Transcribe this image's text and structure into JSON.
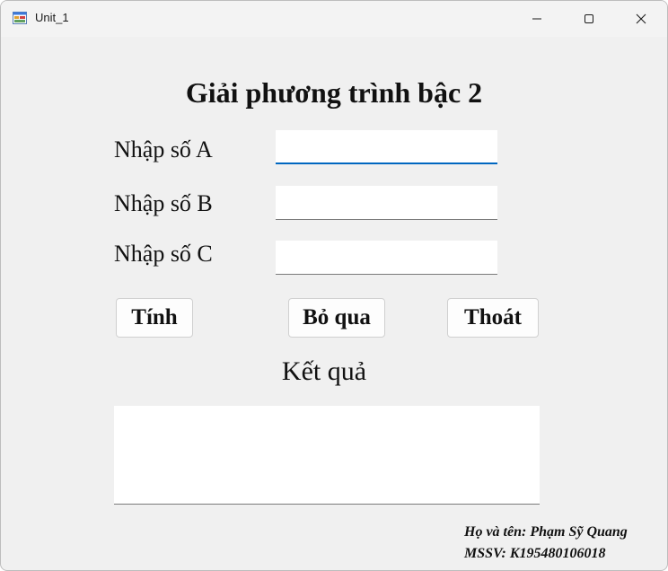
{
  "window": {
    "title": "Unit_1"
  },
  "form": {
    "heading": "Giải phương trình bậc 2",
    "labels": {
      "a": "Nhập số A",
      "b": "Nhập số B",
      "c": "Nhập số C"
    },
    "inputs": {
      "a": "",
      "b": "",
      "c": ""
    },
    "buttons": {
      "calculate": "Tính",
      "skip": "Bỏ qua",
      "exit": "Thoát"
    },
    "result_label": "Kết quả",
    "result_value": "",
    "author_name": "Họ và tên: Phạm Sỹ Quang",
    "student_id": "MSSV: K195480106018"
  },
  "colors": {
    "background": "#f0f0f0",
    "focus_accent": "#0067c0"
  },
  "icons": [
    "app-icon",
    "minimize-icon",
    "maximize-icon",
    "close-icon"
  ]
}
